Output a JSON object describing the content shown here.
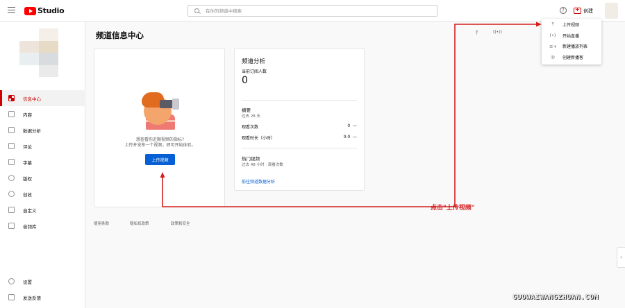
{
  "topbar": {
    "logo_text": "Studio",
    "search_placeholder": "在你的频道中搜索",
    "help_glyph": "?",
    "create_label": "创建"
  },
  "sidebar": {
    "items": [
      {
        "label": "信息中心",
        "icon": "dashboard-icon",
        "active": true
      },
      {
        "label": "内容",
        "icon": "content-icon"
      },
      {
        "label": "数据分析",
        "icon": "analytics-icon"
      },
      {
        "label": "评论",
        "icon": "comments-icon"
      },
      {
        "label": "字幕",
        "icon": "subtitles-icon"
      },
      {
        "label": "版权",
        "icon": "copyright-icon"
      },
      {
        "label": "创收",
        "icon": "monetization-icon"
      },
      {
        "label": "自定义",
        "icon": "customization-icon"
      },
      {
        "label": "音频库",
        "icon": "audio-library-icon"
      }
    ],
    "bottom_items": [
      {
        "label": "设置",
        "icon": "settings-icon"
      },
      {
        "label": "发送反馈",
        "icon": "feedback-icon"
      }
    ]
  },
  "main": {
    "page_title": "频道信息中心",
    "upload_card": {
      "message_line1": "想查看你近期视频的指标?",
      "message_line2": "上传并发布一个视频，即可开始体验。",
      "button_label": "上传视频"
    },
    "analytics_card": {
      "title": "频道分析",
      "subscribers_label": "当前订阅人数",
      "subscribers_value": "0",
      "summary_title": "摘要",
      "summary_period": "过去 28 天",
      "rows": [
        {
          "label": "观看次数",
          "value": "0",
          "trend": "—"
        },
        {
          "label": "观看时长（小时）",
          "value": "0.0",
          "trend": "—"
        }
      ],
      "hot_title": "热门视频",
      "hot_sub": "过去 48 小时 · 观看次数",
      "link": "前往频道数据分析"
    },
    "footer_links": [
      "使用条款",
      "隐私权政策",
      "政策和安全"
    ]
  },
  "create_menu": {
    "items": [
      {
        "label": "上传视频",
        "glyph": "⤒"
      },
      {
        "label": "开始直播",
        "glyph": "(•)"
      },
      {
        "label": "新建播放列表",
        "glyph": "≡+"
      },
      {
        "label": "创建新播客",
        "glyph": "◎"
      }
    ]
  },
  "annotation": {
    "label": "点击\"上传视频\"",
    "color": "#d41e1e"
  },
  "watermark": "GUOWAIWANGZHUAN.COM"
}
